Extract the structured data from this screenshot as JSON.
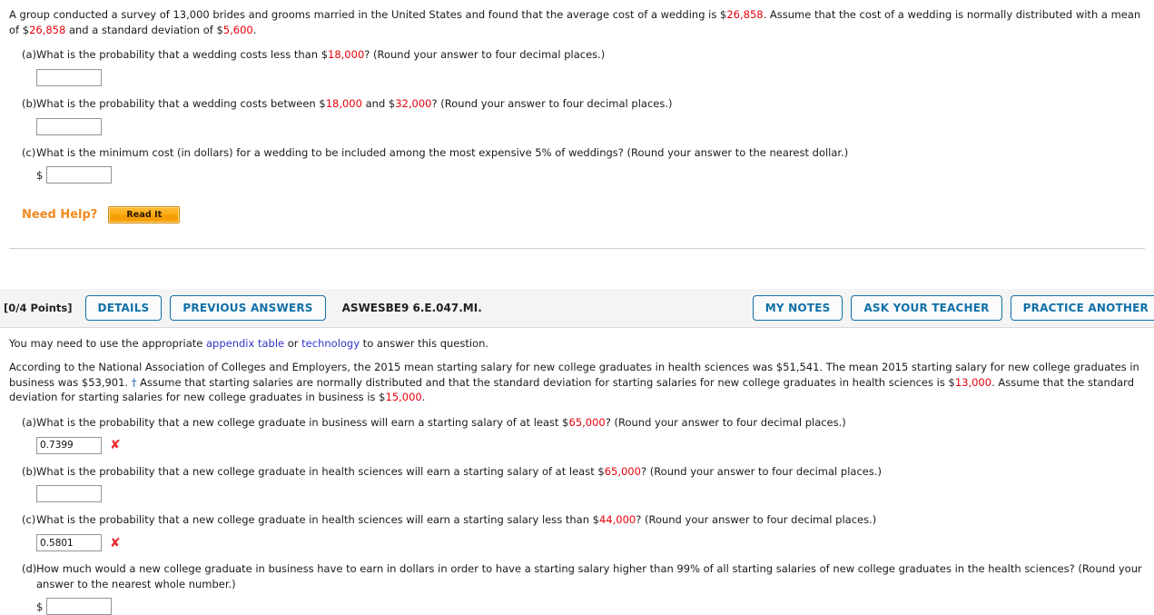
{
  "question1": {
    "stem_parts": [
      {
        "t": "A group conducted a survey of 13,000 brides and grooms married in the United States and found that the average cost of a wedding is $",
        "c": "plain"
      },
      {
        "t": "26,858",
        "c": "red"
      },
      {
        "t": ". Assume that the cost of a wedding is normally distributed with a mean of $",
        "c": "plain"
      },
      {
        "t": "26,858",
        "c": "red"
      },
      {
        "t": " and a standard deviation of $",
        "c": "plain"
      },
      {
        "t": "5,600",
        "c": "red"
      },
      {
        "t": ".",
        "c": "plain"
      }
    ],
    "parts": [
      {
        "label": "(a)",
        "text_parts": [
          {
            "t": "What is the probability that a wedding costs less than $",
            "c": "plain"
          },
          {
            "t": "18,000",
            "c": "red"
          },
          {
            "t": "? (Round your answer to four decimal places.)",
            "c": "plain"
          }
        ],
        "prefix": "",
        "value": "",
        "mark": ""
      },
      {
        "label": "(b)",
        "text_parts": [
          {
            "t": "What is the probability that a wedding costs between $",
            "c": "plain"
          },
          {
            "t": "18,000",
            "c": "red"
          },
          {
            "t": " and $",
            "c": "plain"
          },
          {
            "t": "32,000",
            "c": "red"
          },
          {
            "t": "? (Round your answer to four decimal places.)",
            "c": "plain"
          }
        ],
        "prefix": "",
        "value": "",
        "mark": ""
      },
      {
        "label": "(c)",
        "text_parts": [
          {
            "t": "What is the minimum cost (in dollars) for a wedding to be included among the most expensive 5% of weddings? (Round your answer to the nearest dollar.)",
            "c": "plain"
          }
        ],
        "prefix": "$",
        "value": "",
        "mark": ""
      }
    ],
    "need_help_label": "Need Help?",
    "read_it_label": "Read It"
  },
  "question2": {
    "header": {
      "points": "[0/4 Points]",
      "details_label": "DETAILS",
      "previous_answers_label": "PREVIOUS ANSWERS",
      "question_code": "ASWESBE9 6.E.047.MI.",
      "my_notes_label": "MY NOTES",
      "ask_teacher_label": "ASK YOUR TEACHER",
      "practice_another_label": "PRACTICE ANOTHER"
    },
    "hint_parts": [
      {
        "t": "You may need to use the appropriate ",
        "c": "plain"
      },
      {
        "t": "appendix table",
        "c": "link"
      },
      {
        "t": " or ",
        "c": "plain"
      },
      {
        "t": "technology",
        "c": "link"
      },
      {
        "t": " to answer this question.",
        "c": "plain"
      }
    ],
    "stem_parts": [
      {
        "t": "According to the National Association of Colleges and Employers, the 2015 mean starting salary for new college graduates in health sciences was $51,541. The mean 2015 starting salary for new college graduates in business was $53,901. ",
        "c": "plain"
      },
      {
        "t": "†",
        "c": "dagger"
      },
      {
        "t": " Assume that starting salaries are normally distributed and that the standard deviation for starting salaries for new college graduates in health sciences is $",
        "c": "plain"
      },
      {
        "t": "13,000",
        "c": "red"
      },
      {
        "t": ". Assume that the standard deviation for starting salaries for new college graduates in business is $",
        "c": "plain"
      },
      {
        "t": "15,000",
        "c": "red"
      },
      {
        "t": ".",
        "c": "plain"
      }
    ],
    "parts": [
      {
        "label": "(a)",
        "text_parts": [
          {
            "t": "What is the probability that a new college graduate in business will earn a starting salary of at least $",
            "c": "plain"
          },
          {
            "t": "65,000",
            "c": "red"
          },
          {
            "t": "? (Round your answer to four decimal places.)",
            "c": "plain"
          }
        ],
        "prefix": "",
        "value": "0.7399",
        "mark": "✘"
      },
      {
        "label": "(b)",
        "text_parts": [
          {
            "t": "What is the probability that a new college graduate in health sciences will earn a starting salary of at least $",
            "c": "plain"
          },
          {
            "t": "65,000",
            "c": "red"
          },
          {
            "t": "? (Round your answer to four decimal places.)",
            "c": "plain"
          }
        ],
        "prefix": "",
        "value": "",
        "mark": ""
      },
      {
        "label": "(c)",
        "text_parts": [
          {
            "t": "What is the probability that a new college graduate in health sciences will earn a starting salary less than $",
            "c": "plain"
          },
          {
            "t": "44,000",
            "c": "red"
          },
          {
            "t": "? (Round your answer to four decimal places.)",
            "c": "plain"
          }
        ],
        "prefix": "",
        "value": "0.5801",
        "mark": "✘"
      },
      {
        "label": "(d)",
        "text_parts": [
          {
            "t": "How much would a new college graduate in business have to earn in dollars in order to have a starting salary higher than 99% of all starting salaries of new college graduates in the health sciences? (Round your answer to the nearest whole number.)",
            "c": "plain"
          }
        ],
        "prefix": "$",
        "value": "",
        "mark": ""
      }
    ]
  },
  "colors": {
    "red_value": "#e8000d",
    "link_blue": "#3333cc",
    "button_blue": "#1071a8",
    "need_help_orange": "#f08a1e",
    "wrong_mark": "#ec2d2d"
  }
}
